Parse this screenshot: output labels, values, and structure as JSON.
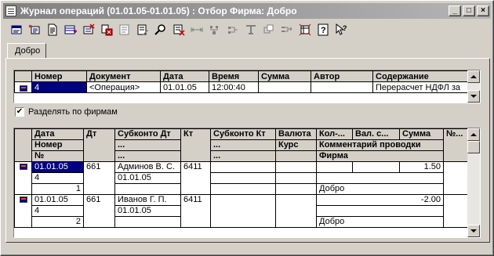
{
  "window": {
    "title": "Журнал операций (01.01.05-01.01.05) : Отбор Фирма: Добро",
    "buttons": {
      "minimize": "_",
      "maximize": "□",
      "close": "×"
    }
  },
  "toolbar": {
    "icons": [
      "new-operation-icon",
      "copy-operation-icon",
      "open-document-icon",
      "new-row-icon",
      "delete-row-icon",
      "mark-delete-icon",
      "post-icon",
      "edit-icon",
      "find-icon",
      "unpost-icon",
      "interval-icon",
      "filter-icon",
      "filter-off-icon",
      "structure-icon",
      "move-icon",
      "delete-icon",
      "journal-settings-icon",
      "help-icon",
      "context-help-icon"
    ]
  },
  "tabs": [
    {
      "label": "Добро"
    }
  ],
  "operations": {
    "columns": [
      "Номер",
      "Документ",
      "Дата",
      "Время",
      "Сумма",
      "Автор",
      "Содержание"
    ],
    "rows": [
      {
        "number": "4",
        "document": "<Операция>",
        "date": "01.01.05",
        "time": "12:00:40",
        "sum": "",
        "author": "",
        "content": "Перерасчет НДФЛ за"
      }
    ]
  },
  "split_checkbox": {
    "checked": true,
    "mark": "✔",
    "label": "Разделять по фирмам"
  },
  "entries": {
    "header": {
      "date": "Дата",
      "number": "Номер",
      "no": "№",
      "dt": "Дт",
      "subconto_dt": "Субконто Дт",
      "dots1": "...",
      "dots2": "...",
      "kt": "Кт",
      "subconto_kt": "Субконто Кт",
      "dots3": "...",
      "dots4": "...",
      "currency": "Валюта",
      "rate": "Курс",
      "qty": "Кол-...",
      "cur_sum": "Вал. с...",
      "sum": "Сумма",
      "comment": "Комментарий проводки",
      "firm": "Фирма",
      "n_no": "№..."
    },
    "rows": [
      {
        "date": "01.01.05",
        "number": "4",
        "line": "1",
        "dt": "661",
        "sub_dt_1": "Админов В. С.",
        "sub_dt_2": "01.01.05",
        "kt": "6411",
        "sum": "1.50",
        "firm": "Добро"
      },
      {
        "date": "01.01.05",
        "number": "4",
        "line": "2",
        "dt": "661",
        "sub_dt_1": "Иванов Г. П.",
        "sub_dt_2": "01.01.05",
        "kt": "6411",
        "sum": "-2.00",
        "firm": "Добро"
      }
    ]
  }
}
